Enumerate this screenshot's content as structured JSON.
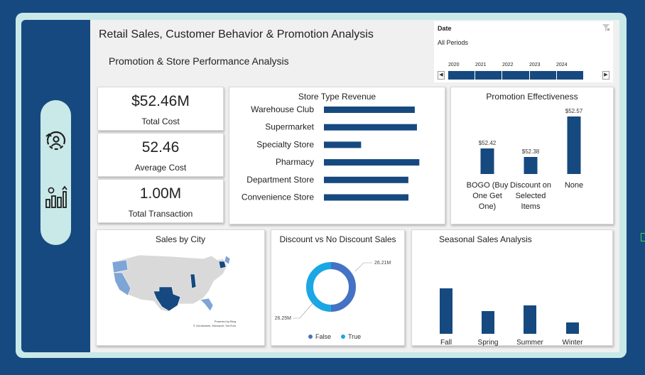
{
  "header": {
    "title": "Retail Sales, Customer Behavior & Promotion Analysis",
    "subtitle": "Promotion & Store Performance Analysis"
  },
  "nav": {
    "items": [
      {
        "icon": "customer-behavior-icon"
      },
      {
        "icon": "sales-growth-icon"
      }
    ]
  },
  "date_slicer": {
    "label": "Date",
    "value": "All Periods",
    "years": [
      "2020",
      "2021",
      "2022",
      "2023",
      "2024"
    ]
  },
  "kpis": {
    "total_cost": {
      "value": "$52.46M",
      "label": "Total Cost"
    },
    "average_cost": {
      "value": "52.46",
      "label": "Average Cost"
    },
    "total_transaction": {
      "value": "1.00M",
      "label": "Total Transaction"
    }
  },
  "colors": {
    "primary": "#16497f",
    "donut_false": "#4472c4",
    "donut_true": "#1aa7e4",
    "map_highlight": "#16497f",
    "map_light": "#7fa4d6",
    "map_base": "#d9d9d9",
    "frame": "#c9e8e8"
  },
  "map_card": {
    "title": "Sales by City",
    "credit_line1": "Powered by Bing",
    "credit_line2": "© GeoNames, Microsoft, TomTom"
  },
  "chart_data": [
    {
      "type": "bar",
      "orientation": "horizontal",
      "title": "Store Type Revenue",
      "categories": [
        "Warehouse Club",
        "Supermarket",
        "Specialty Store",
        "Pharmacy",
        "Department Store",
        "Convenience Store"
      ],
      "values": [
        8.77,
        8.98,
        3.59,
        9.21,
        8.15,
        8.16
      ],
      "xlim": [
        0,
        9.6
      ]
    },
    {
      "type": "bar",
      "title": "Promotion Effectiveness",
      "categories": [
        "BOGO (Buy One Get One)",
        "Discount on Selected Items",
        "None"
      ],
      "category_lines": [
        [
          "BOGO (Buy",
          "One Get",
          "One)"
        ],
        [
          "Discount on",
          "Selected",
          "Items"
        ],
        [
          "None"
        ]
      ],
      "values": [
        52.42,
        52.38,
        52.57
      ],
      "data_labels": [
        "$52.42",
        "$52.38",
        "$52.57"
      ],
      "ylim": [
        52.3,
        52.6
      ]
    },
    {
      "type": "pie",
      "subtype": "donut",
      "title": "Discount vs No Discount Sales",
      "categories": [
        "False",
        "True"
      ],
      "values": [
        26.25,
        26.21
      ],
      "data_labels": [
        "26.25M",
        "26.21M"
      ],
      "legend": "bottom"
    },
    {
      "type": "bar",
      "title": "Seasonal Sales Analysis",
      "categories": [
        "Fall",
        "Spring",
        "Summer",
        "Winter"
      ],
      "values": [
        13.2,
        13.0,
        13.05,
        12.9
      ],
      "ylim": [
        12.8,
        13.3
      ]
    }
  ]
}
